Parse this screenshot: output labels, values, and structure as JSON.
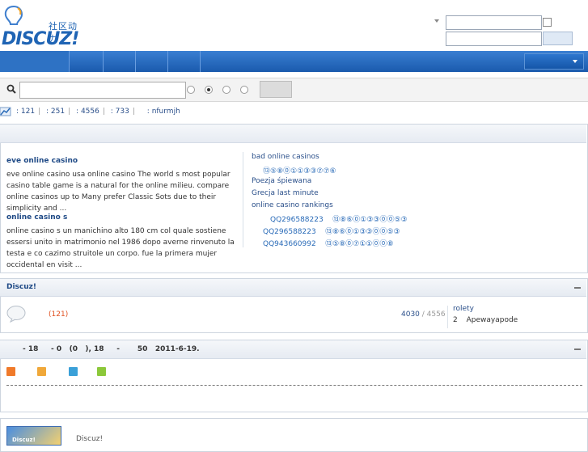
{
  "header": {
    "logo_slogan": "社区动力",
    "logo_word": "DISCUZ!",
    "username_value": "",
    "password_value": ""
  },
  "search": {
    "query_value": ""
  },
  "stats": [
    "121",
    "251",
    "4556",
    "733"
  ],
  "stats_user": "nfurmjh",
  "articles": [
    {
      "title": "eve online casino",
      "body": "eve online casino usa online casino The world s most popular casino table game is a natural for the online milieu. compare online casinos up to Many prefer Classic Sots due to their simplicity and ..."
    },
    {
      "title": "online casino s",
      "body": "online casino s un manichino alto 180 cm col quale sostiene essersi unito in matrimonio nel 1986 dopo averne rinvenuto la testa e co cazimo struitole un corpo. fue la primera mujer occidental en visit ..."
    }
  ],
  "links": [
    {
      "text": "bad online casinos",
      "type": "link"
    },
    {
      "text": "⑬⑤⑧⓪①①③③⑦⑦⑥",
      "type": "circ"
    },
    {
      "text": "Poezja śpiewana",
      "type": "link"
    },
    {
      "text": "Grecja last minute",
      "type": "link"
    },
    {
      "text": "online casino rankings",
      "type": "link"
    },
    {
      "text": "QQ296588223    ⑬⑧⑥⓪①③③⓪⓪⑤③",
      "type": "circ"
    },
    {
      "text": "QQ296588223    ⑬⑧⑥⓪①③③⓪⓪⑤③",
      "type": "circ"
    },
    {
      "text": "QQ943660992    ⑬⑤⑧⓪⑦①①⓪⓪⑧",
      "type": "circ"
    }
  ],
  "forum": {
    "title": "Discuz!",
    "count": "(121)",
    "threads": "4030",
    "posts": "4556",
    "last_title": "rolety",
    "last_num": "2",
    "last_user": "Apewayapode"
  },
  "online": {
    "summary": "- 18     - 0   (0   ), 18     -       50   2011-6-19."
  },
  "footer": {
    "logo_text": "Discuz!",
    "text": "Discuz!"
  },
  "colors": {
    "accent": "#1f64b4",
    "nav": "#2366b8"
  }
}
